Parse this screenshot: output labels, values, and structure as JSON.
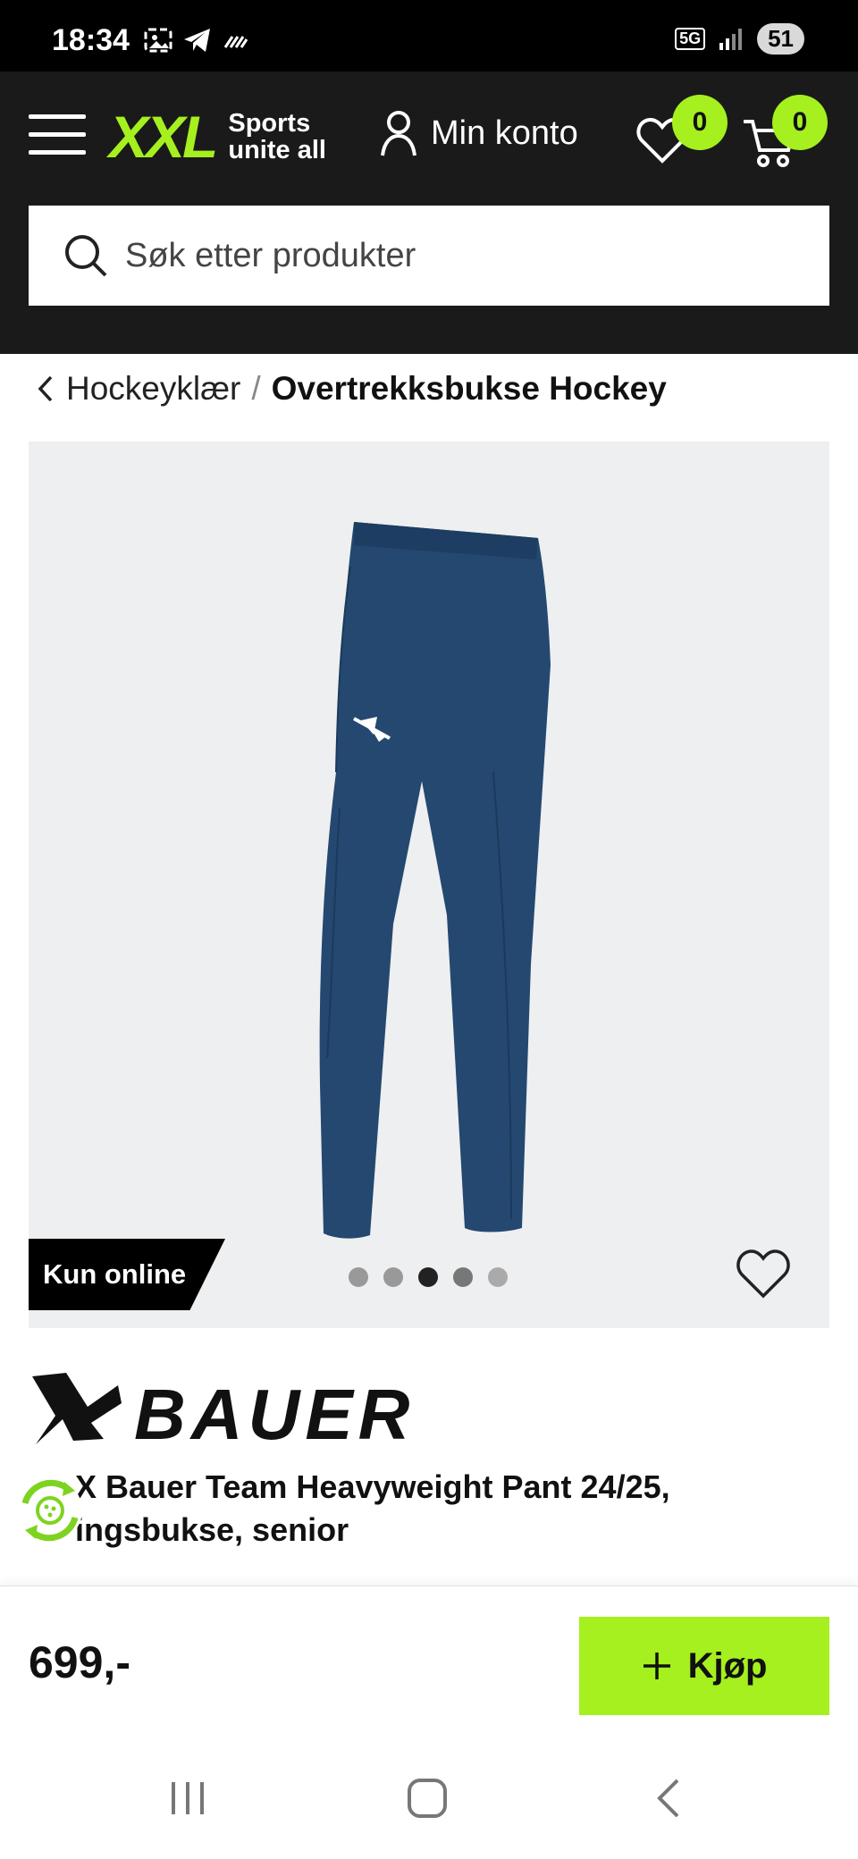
{
  "status_bar": {
    "time": "18:34",
    "network": "5G",
    "battery": "51"
  },
  "header": {
    "logo_main": "XXL",
    "logo_tagline_1": "Sports",
    "logo_tagline_2": "unite all",
    "account_label": "Min konto",
    "wishlist_count": "0",
    "cart_count": "0",
    "accent_color": "#a5f01e"
  },
  "search": {
    "placeholder": "Søk etter produkter"
  },
  "breadcrumb": {
    "parent": "Hockeyklær",
    "separator": "/",
    "current": "Overtrekksbukse Hockey"
  },
  "gallery": {
    "tag": "Kun online",
    "image_count": 5,
    "active_index": 2
  },
  "product": {
    "brand": "BAUER",
    "title_line_1": "X Bauer Team Heavyweight Pant 24/25,",
    "title_line_2": "ingsbukse, senior",
    "price": "699,-",
    "buy_label": "Kjøp"
  }
}
